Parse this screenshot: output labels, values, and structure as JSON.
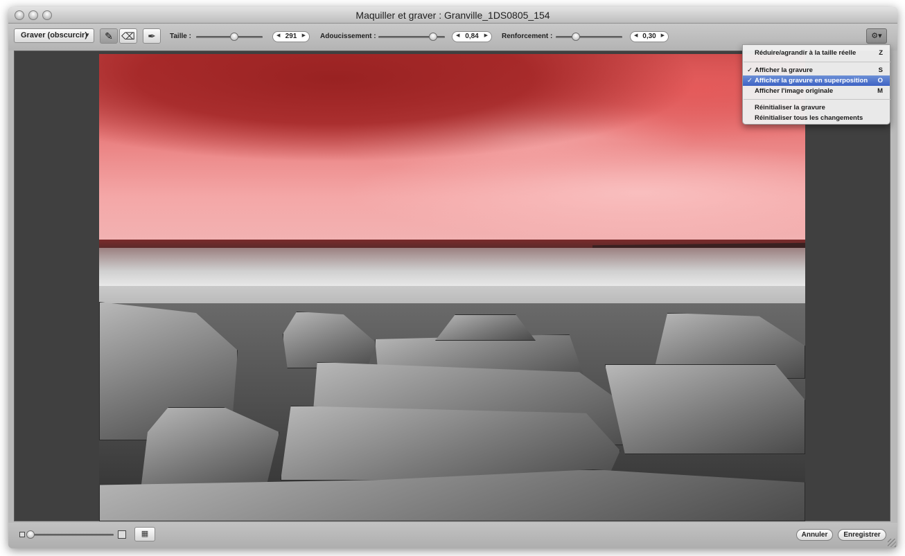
{
  "window": {
    "title": "Maquiller et graver : Granville_1DS0805_154"
  },
  "toolbar": {
    "mode_label": "Graver (obscurcir)",
    "taille_label": "Taille :",
    "taille_value": "291",
    "adoucissement_label": "Adoucissement :",
    "adoucissement_value": "0,84",
    "renforcement_label": "Renforcement :",
    "renforcement_value": "0,30",
    "brush_icon": "brush-icon",
    "eraser_icon": "eraser-icon",
    "feather_icon": "feather-brush-icon",
    "gear_icon": "gear-icon"
  },
  "menu": {
    "items": [
      {
        "label": "Réduire/agrandir à la taille réelle",
        "shortcut": "Z",
        "checked": ""
      },
      {
        "label": "Afficher la gravure",
        "shortcut": "S",
        "checked": "✓"
      },
      {
        "label": "Afficher la gravure en superposition",
        "shortcut": "O",
        "checked": "✓"
      },
      {
        "label": "Afficher l'image originale",
        "shortcut": "M",
        "checked": ""
      },
      {
        "label": "Réinitialiser la gravure",
        "shortcut": "",
        "checked": ""
      },
      {
        "label": "Réinitialiser tous les changements",
        "shortcut": "",
        "checked": ""
      }
    ],
    "highlighted_index": 2
  },
  "footer": {
    "cancel_label": "Annuler",
    "save_label": "Enregistrer"
  },
  "colors": {
    "overlay": "#d83a3a",
    "highlight": "#3d62c4"
  }
}
